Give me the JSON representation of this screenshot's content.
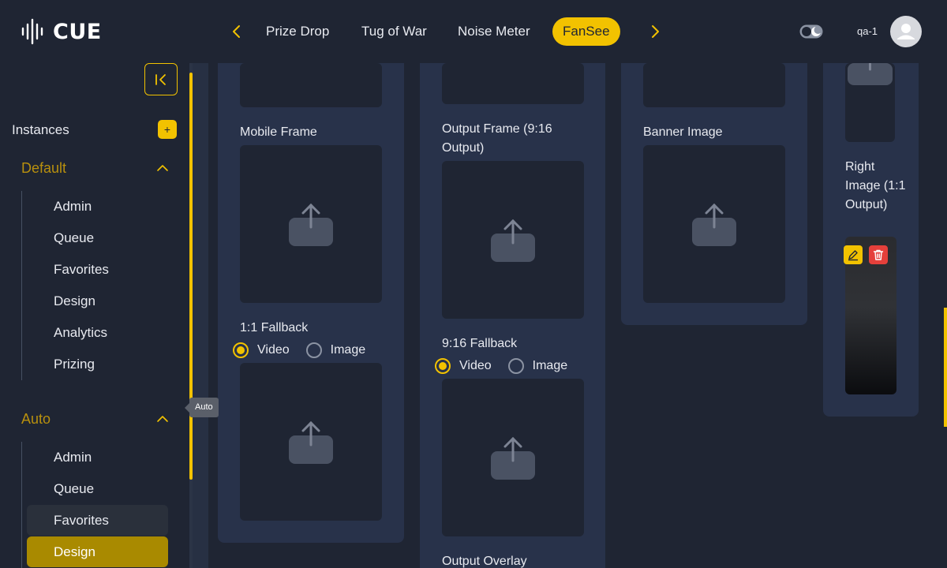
{
  "header": {
    "logo_text": "CUE",
    "tabs": [
      {
        "label": "Prize Drop",
        "active": false
      },
      {
        "label": "Tug of War",
        "active": false
      },
      {
        "label": "Noise Meter",
        "active": false
      },
      {
        "label": "FanSee",
        "active": true
      }
    ],
    "username": "qa-1",
    "icons": [
      "chevron-left-icon",
      "chevron-right-icon",
      "theme-toggle-icon",
      "user-avatar-icon"
    ]
  },
  "sidebar": {
    "instances_label": "Instances",
    "add_label": "+",
    "groups": [
      {
        "title": "Default",
        "expanded": true,
        "items": [
          "Admin",
          "Queue",
          "Favorites",
          "Design",
          "Analytics",
          "Prizing"
        ]
      },
      {
        "title": "Auto",
        "expanded": true,
        "items": [
          "Admin",
          "Queue",
          "Favorites",
          "Design"
        ],
        "hover_item": "Favorites",
        "active_item": "Design"
      }
    ],
    "tooltip": "Auto"
  },
  "main": {
    "column1": {
      "mobile_frame_label": "Mobile Frame",
      "fallback_label": "1:1 Fallback",
      "radio_options": [
        "Video",
        "Image"
      ],
      "selected": "Video"
    },
    "column2": {
      "output_frame_label": "Output Frame (9:16 Output)",
      "fallback_label": "9:16 Fallback",
      "radio_options": [
        "Video",
        "Image"
      ],
      "selected": "Video",
      "overlay_label": "Output Overlay"
    },
    "column3": {
      "banner_label": "Banner Image"
    },
    "column4": {
      "right_image_label": "Right Image (1:1 Output)"
    }
  },
  "colors": {
    "accent": "#f2c200",
    "background": "#1f2533",
    "card": "#28324a",
    "danger": "#e5403b"
  }
}
